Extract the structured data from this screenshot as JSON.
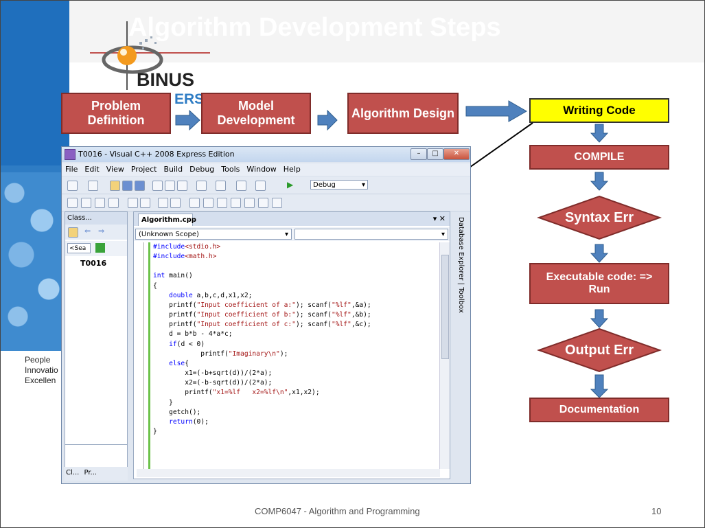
{
  "slide": {
    "title": "Algorithm Development Steps",
    "logo_text": "BINUS",
    "logo_sub": "ERS",
    "motto": [
      "People",
      "Innovatio",
      "Excellen"
    ],
    "footer": "COMP6047 - Algorithm and Programming",
    "page_number": "10"
  },
  "flow_top": [
    "Problem Definition",
    "Model Development",
    "Algorithm Design",
    "Writing Code"
  ],
  "flow_column": {
    "compile": "COMPILE",
    "syntax_err": "Syntax Err",
    "executable": "Executable code: => Run",
    "output_err": "Output Err",
    "documentation": "Documentation"
  },
  "colors": {
    "box_fill": "#c0504d",
    "arrow_fill": "#4f81bd",
    "highlight": "#ffff00"
  },
  "ide": {
    "window_title": "T0016 - Visual C++ 2008 Express Edition",
    "menu": [
      "File",
      "Edit",
      "View",
      "Project",
      "Build",
      "Debug",
      "Tools",
      "Window",
      "Help"
    ],
    "config": "Debug",
    "panel_title": "Class...",
    "search_label": "<Sea",
    "tree_item": "T0016",
    "bottom_tabs": [
      "Cl...",
      "Pr..."
    ],
    "file_tab": "Algorithm.cpp",
    "scope": "(Unknown Scope)",
    "side_panel": [
      "Database Explorer",
      "Toolbox"
    ],
    "code_lines": [
      "#include<stdio.h>",
      "#include<math.h>",
      "",
      "int main()",
      "{",
      "    double a,b,c,d,x1,x2;",
      "    printf(\"Input coefficient of a:\"); scanf(\"%lf\",&a);",
      "    printf(\"Input coefficient of b:\"); scanf(\"%lf\",&b);",
      "    printf(\"Input coefficient of c:\"); scanf(\"%lf\",&c);",
      "    d = b*b - 4*a*c;",
      "    if(d < 0)",
      "            printf(\"Imaginary\\n\");",
      "    else{",
      "        x1=(-b+sqrt(d))/(2*a);",
      "        x2=(-b-sqrt(d))/(2*a);",
      "        printf(\"x1=%lf   x2=%lf\\n\",x1,x2);",
      "    }",
      "    getch();",
      "    return(0);",
      "}"
    ]
  }
}
